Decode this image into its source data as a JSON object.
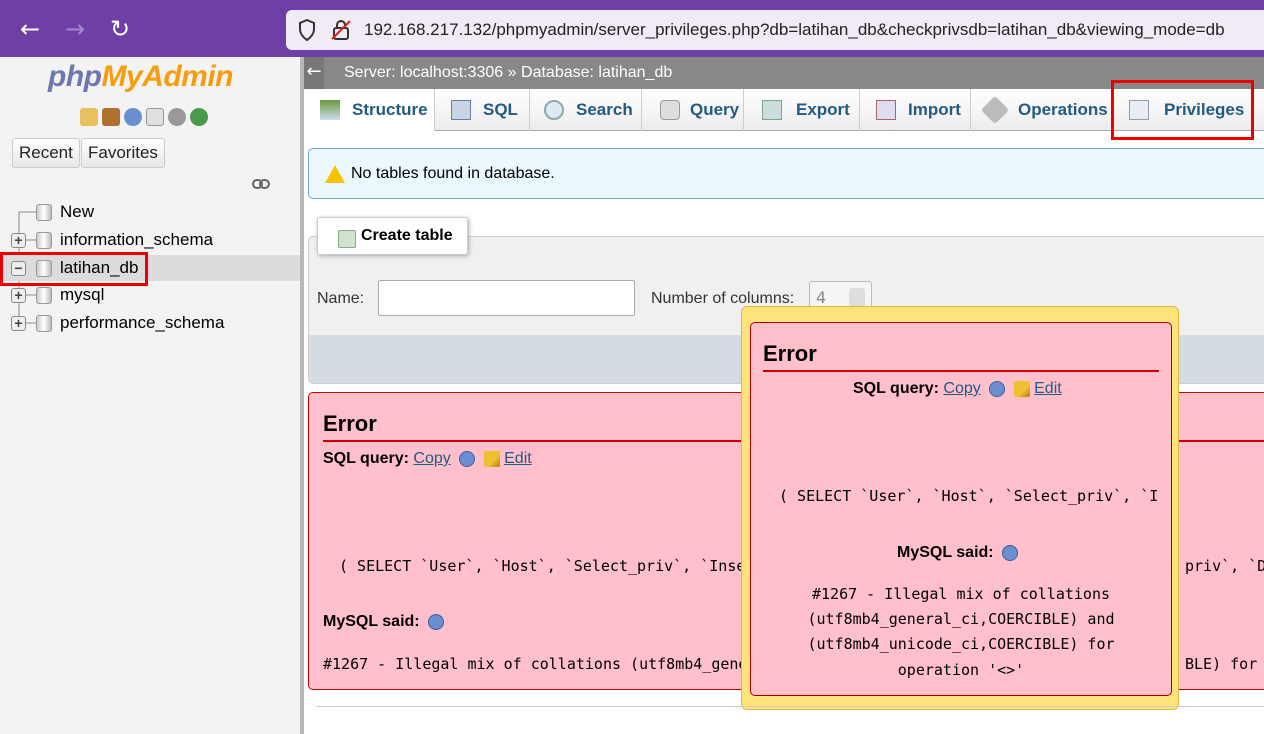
{
  "browser": {
    "back": "←",
    "forward": "→",
    "reload": "↻",
    "url": "192.168.217.132/phpmyadmin/server_privileges.php?db=latihan_db&checkprivsdb=latihan_db&viewing_mode=db"
  },
  "sidebar": {
    "logo_php": "php",
    "logo_myadmin": "MyAdmin",
    "icons": [
      "home-icon",
      "exit-icon",
      "help-icon",
      "docs-icon",
      "gear-icon",
      "reload-icon"
    ],
    "recent": "Recent",
    "favorites": "Favorites",
    "tree": [
      {
        "label": "New"
      },
      {
        "label": "information_schema"
      },
      {
        "label": "latihan_db"
      },
      {
        "label": "mysql"
      },
      {
        "label": "performance_schema"
      }
    ]
  },
  "topbar": {
    "back": "←",
    "server": "Server: localhost:3306",
    "sep": "»",
    "database": "Database: latihan_db"
  },
  "tabs": [
    {
      "label": "Structure",
      "icon": "structure-icon"
    },
    {
      "label": "SQL",
      "icon": "sql-icon"
    },
    {
      "label": "Search",
      "icon": "search-icon"
    },
    {
      "label": "Query",
      "icon": "query-icon"
    },
    {
      "label": "Export",
      "icon": "export-icon"
    },
    {
      "label": "Import",
      "icon": "import-icon"
    },
    {
      "label": "Operations",
      "icon": "operations-icon"
    },
    {
      "label": "Privileges",
      "icon": "privileges-icon"
    }
  ],
  "notice": "No tables found in database.",
  "create_table": {
    "legend": "Create table",
    "name_label": "Name:",
    "cols_label": "Number of columns:",
    "cols_value": "4"
  },
  "error_main": {
    "title": "Error",
    "sql_query_label": "SQL query:",
    "copy": "Copy",
    "edit": "Edit",
    "query": "( SELECT `User`, `Host`, `Select_priv`, `Inse",
    "query_tail": "priv`, `Dr",
    "mysql_said": "MySQL said:",
    "message": "#1267 - Illegal mix of collations (utf8mb4_gene",
    "message_tail": "BLE) for o"
  },
  "error_popup": {
    "title": "Error",
    "sql_query_label": "SQL query:",
    "copy": "Copy",
    "edit": "Edit",
    "query": "( SELECT `User`, `Host`, `Select_priv`, `I",
    "mysql_said": "MySQL said:",
    "message_lines": [
      "#1267 - Illegal mix of collations",
      "(utf8mb4_general_ci,COERCIBLE) and",
      "(utf8mb4_unicode_ci,COERCIBLE) for",
      "operation '<>'"
    ]
  },
  "colors": {
    "browser": "#6e3fa5",
    "error_bg": "#ffc0cb",
    "popup": "#ffe27a",
    "link": "#235a81",
    "highlight": "#e00000"
  }
}
